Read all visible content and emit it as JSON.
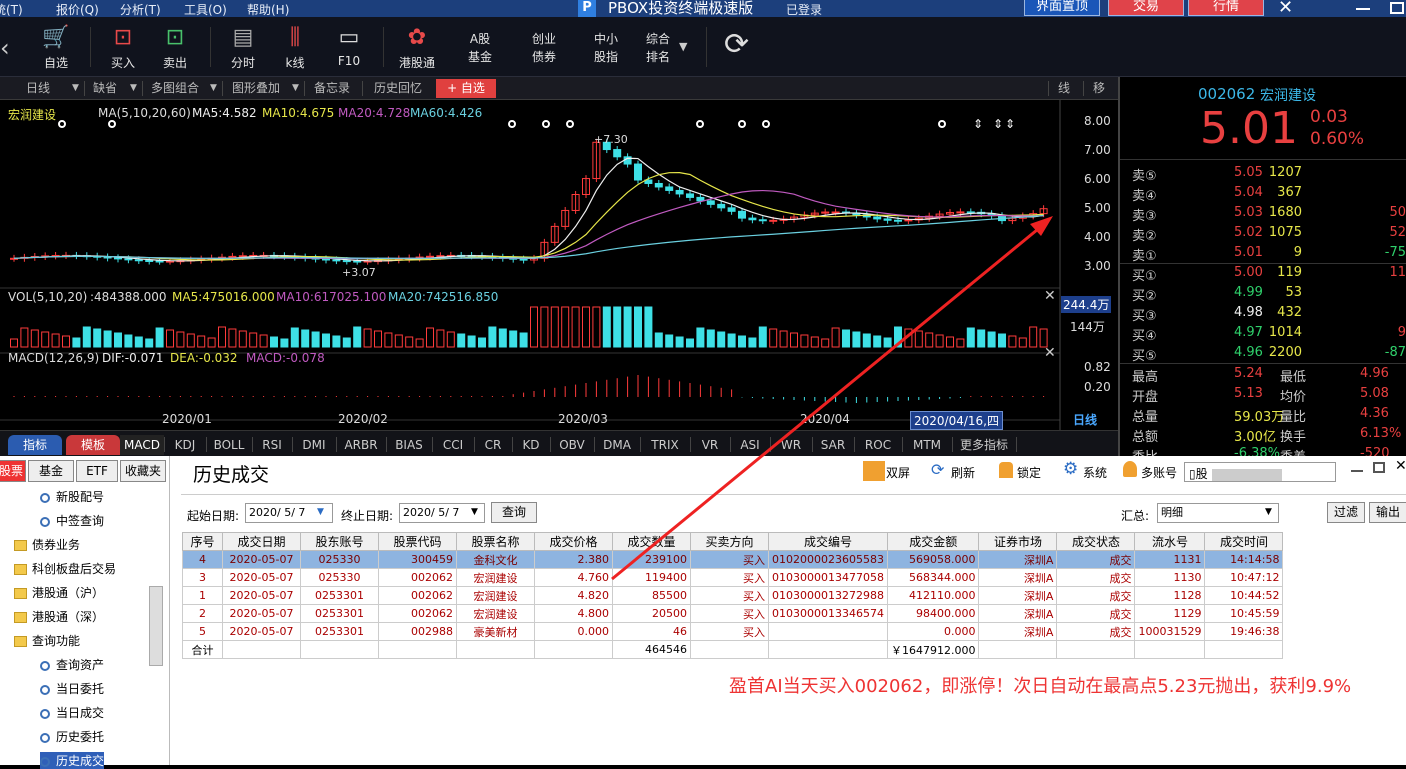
{
  "menu": {
    "items": [
      "统(T)",
      "报价(Q)",
      "分析(T)",
      "工具(O)",
      "帮助(H)"
    ],
    "app_title": "PBOX投资终端极速版",
    "logo": "P",
    "login_status": "已登录",
    "buttons": [
      "界面置顶",
      "交易",
      "行情"
    ],
    "close": "✕"
  },
  "toolbar": {
    "items": [
      {
        "icon": "🛒",
        "label": "自选"
      },
      {
        "icon": "⊡",
        "label": "买入"
      },
      {
        "icon": "⊡",
        "label": "卖出"
      },
      {
        "icon": "▤",
        "label": "分时"
      },
      {
        "icon": "⫼",
        "label": "k线"
      },
      {
        "icon": "▭",
        "label": "F10"
      },
      {
        "icon": "✿",
        "label": "港股通"
      }
    ],
    "two_line": [
      {
        "l1": "A股",
        "l2": "基金"
      },
      {
        "l1": "创业",
        "l2": "债券"
      },
      {
        "l1": "中小",
        "l2": "股指"
      },
      {
        "l1": "综合",
        "l2": "排名"
      }
    ],
    "refresh": "⟳"
  },
  "chart_tabs": [
    "日线",
    "缺省",
    "多图组合",
    "图形叠加",
    "备忘录",
    "历史回忆",
    "+ 自选"
  ],
  "chart_tabs_right": [
    "线",
    "移"
  ],
  "chart": {
    "stock": "宏润建设",
    "ma_title": "MA(5,10,20,60)",
    "ma5": "MA5:4.582",
    "ma10": "MA10:4.675",
    "ma20": "MA20:4.728",
    "ma60": "MA60:4.426",
    "high_label": "+7.30",
    "low_label": "+3.07",
    "price_ticks": [
      "8.00",
      "7.00",
      "6.00",
      "5.00",
      "4.00",
      "3.00"
    ],
    "vol_title": "VOL(5,10,20)",
    "vol_value": ":484388.000",
    "vol_ma5": "MA5:475016.000",
    "vol_ma10": "MA10:617025.100",
    "vol_ma20": "MA20:742516.850",
    "vol_ticks": [
      "244.4万",
      "144万"
    ],
    "macd_title": "MACD(12,26,9)",
    "dif": "DIF:-0.071",
    "dea": "DEA:-0.032",
    "macd": "MACD:-0.078",
    "macd_ticks": [
      "0.82",
      "0.20"
    ],
    "dates": [
      "2020/01",
      "2020/02",
      "2020/03",
      "2020/04"
    ],
    "cursor_date": "2020/04/16,四",
    "period": "日线",
    "close_x": "✕"
  },
  "chart_data": {
    "type": "candlestick",
    "title": "宏润建设",
    "x": [
      "2020/01",
      "2020/02",
      "2020/03",
      "2020/04"
    ],
    "ylim": [
      3.0,
      8.0
    ],
    "high": 7.3,
    "low": 3.07,
    "last": 5.01
  },
  "indicator_tabs": {
    "left": [
      "指标",
      "模板"
    ],
    "items": [
      "MACD",
      "KDJ",
      "BOLL",
      "RSI",
      "DMI",
      "ARBR",
      "BIAS",
      "CCI",
      "CR",
      "KD",
      "OBV",
      "DMA",
      "TRIX",
      "VR",
      "ASI",
      "WR",
      "SAR",
      "ROC",
      "MTM",
      "更多指标"
    ]
  },
  "quote": {
    "code": "002062",
    "name": "宏润建设",
    "price": "5.01",
    "change": "0.03",
    "pct": "0.60%",
    "asks": [
      {
        "l": "卖⑤",
        "p": "5.05",
        "v": "1207",
        "x": ""
      },
      {
        "l": "卖④",
        "p": "5.04",
        "v": "367",
        "x": ""
      },
      {
        "l": "卖③",
        "p": "5.03",
        "v": "1680",
        "x": "50"
      },
      {
        "l": "卖②",
        "p": "5.02",
        "v": "1075",
        "x": "52"
      },
      {
        "l": "卖①",
        "p": "5.01",
        "v": "9",
        "x": "-75"
      }
    ],
    "bids": [
      {
        "l": "买①",
        "p": "5.00",
        "v": "119",
        "x": "11"
      },
      {
        "l": "买②",
        "p": "4.99",
        "v": "53",
        "x": ""
      },
      {
        "l": "买③",
        "p": "4.98",
        "v": "432",
        "x": ""
      },
      {
        "l": "买④",
        "p": "4.97",
        "v": "1014",
        "x": "9"
      },
      {
        "l": "买⑤",
        "p": "4.96",
        "v": "2200",
        "x": "-87"
      }
    ],
    "stats": [
      {
        "a": "最高",
        "av": "5.24",
        "b": "最低",
        "bv": "4.96"
      },
      {
        "a": "开盘",
        "av": "5.13",
        "b": "均价",
        "bv": "5.08"
      },
      {
        "a": "总量",
        "av": "59.03万",
        "b": "量比",
        "bv": "4.36"
      },
      {
        "a": "总额",
        "av": "3.00亿",
        "b": "换手",
        "bv": "6.13%"
      },
      {
        "a": "委比",
        "av": "-6.38%",
        "b": "委差",
        "bv": "-520"
      }
    ]
  },
  "tree": {
    "tabs": [
      "股票",
      "基金",
      "ETF",
      "收藏夹"
    ],
    "nodes": [
      "新股配号",
      "中签查询",
      "债券业务",
      "科创板盘后交易",
      "港股通（沪）",
      "港股通（深）",
      "查询功能",
      "查询资产",
      "当日委托",
      "当日成交",
      "历史委托",
      "历史成交"
    ]
  },
  "panel": {
    "title": "历史成交",
    "actions": [
      "双屏",
      "刷新",
      "锁定",
      "系统",
      "多账号"
    ],
    "acct": "股",
    "start_label": "起始日期:",
    "start": "2020/ 5/ 7",
    "end_label": "终止日期:",
    "end": "2020/ 5/ 7",
    "query": "查询",
    "summary_label": "汇总:",
    "summary": "明细",
    "filter": "过滤",
    "export": "输出",
    "headers": [
      "序号",
      "成交日期",
      "股东账号",
      "股票代码",
      "股票名称",
      "成交价格",
      "成交数量",
      "买卖方向",
      "成交编号",
      "成交金额",
      "证券市场",
      "成交状态",
      "流水号",
      "成交时间"
    ],
    "rows": [
      [
        "4",
        "2020-05-07",
        "025330",
        "300459",
        "金科文化",
        "2.380",
        "239100",
        "买入",
        "0102000023605583",
        "569058.000",
        "深圳A",
        "成交",
        "1131",
        "14:14:58"
      ],
      [
        "3",
        "2020-05-07",
        "025330",
        "002062",
        "宏润建设",
        "4.760",
        "119400",
        "买入",
        "0103000013477058",
        "568344.000",
        "深圳A",
        "成交",
        "1130",
        "10:47:12"
      ],
      [
        "1",
        "2020-05-07",
        "0253301",
        "002062",
        "宏润建设",
        "4.820",
        "85500",
        "买入",
        "0103000013272988",
        "412110.000",
        "深圳A",
        "成交",
        "1128",
        "10:44:52"
      ],
      [
        "2",
        "2020-05-07",
        "0253301",
        "002062",
        "宏润建设",
        "4.800",
        "20500",
        "买入",
        "0103000013346574",
        "98400.000",
        "深圳A",
        "成交",
        "1129",
        "10:45:59"
      ],
      [
        "5",
        "2020-05-07",
        "0253301",
        "002988",
        "豪美新材",
        "0.000",
        "46",
        "买入",
        "",
        "0.000",
        "深圳A",
        "成交",
        "100031529",
        "19:46:38"
      ]
    ],
    "total_label": "合计",
    "total_qty": "464546",
    "total_amt": "￥1647912.000"
  },
  "note": "盈首AI当天买入002062，即涨停！次日自动在最高点5.23元抛出，获利9.9%"
}
